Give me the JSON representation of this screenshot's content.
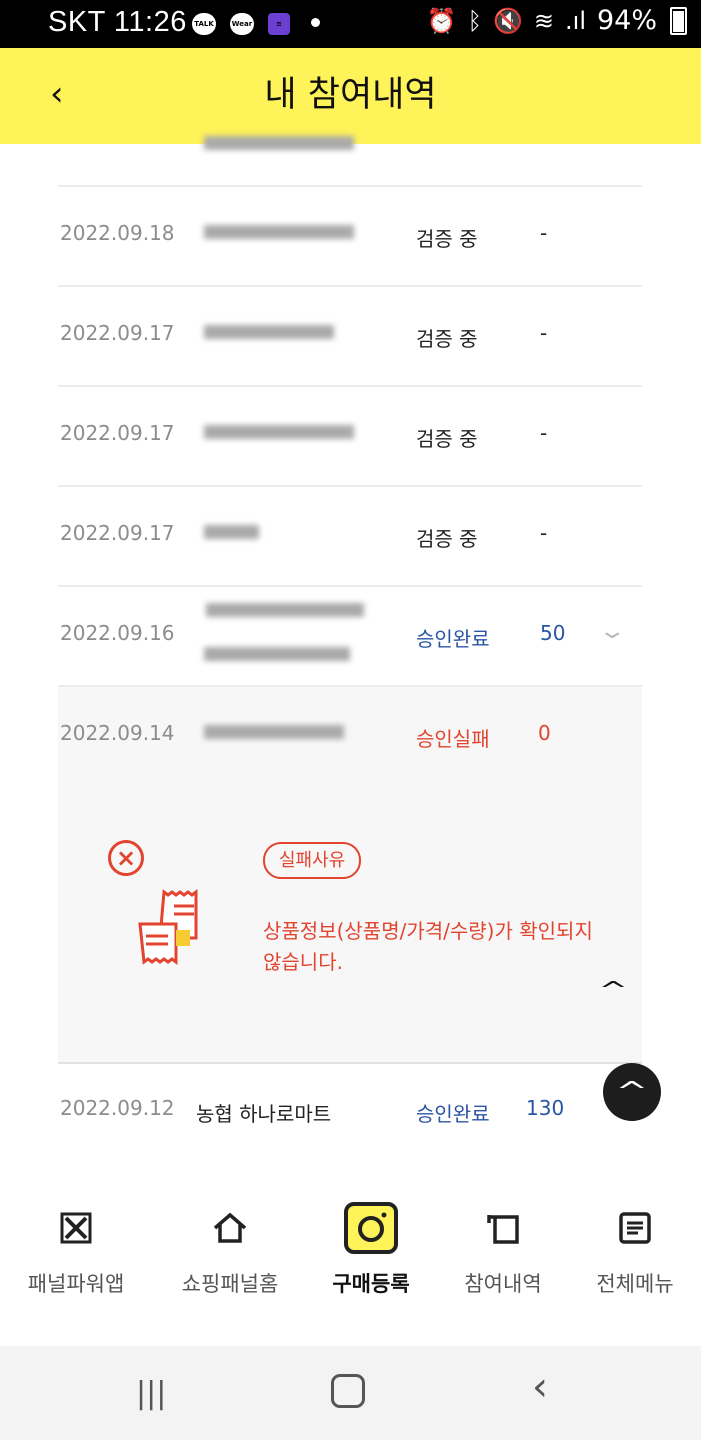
{
  "status_bar": {
    "carrier_time": "SKT 11:26",
    "talk_icon_text": "TALK",
    "wear_icon_text": "Wear",
    "battery": "94%"
  },
  "header": {
    "title": "내 참여내역",
    "back_icon": "back-chevron-icon"
  },
  "rows": [
    {
      "date": "2022.09.18",
      "status": "검증 중",
      "points": "-"
    },
    {
      "date": "2022.09.17",
      "status": "검증 중",
      "points": "-"
    },
    {
      "date": "2022.09.17",
      "status": "검증 중",
      "points": "-"
    },
    {
      "date": "2022.09.17",
      "status": "검증 중",
      "points": "-"
    },
    {
      "date": "2022.09.16",
      "status": "승인완료",
      "points": "50"
    },
    {
      "date": "2022.09.14",
      "status": "승인실패",
      "points": "0"
    }
  ],
  "failure_detail": {
    "badge": "실패사유",
    "reason": "상품정보(상품명/가격/수량)가 확인되지 않습니다."
  },
  "last_row": {
    "date": "2022.09.12",
    "store": "농협 하나로마트",
    "status": "승인완료",
    "points": "130"
  },
  "colors": {
    "header_bg": "#fff35a",
    "approved": "#2a55a4",
    "failed": "#e2442f"
  },
  "bottom_nav": [
    {
      "label": "패널파워앱",
      "icon": "panelpower-icon"
    },
    {
      "label": "쇼핑패널홈",
      "icon": "home-icon"
    },
    {
      "label": "구매등록",
      "icon": "camera-icon",
      "active": true
    },
    {
      "label": "참여내역",
      "icon": "history-icon"
    },
    {
      "label": "전체메뉴",
      "icon": "menu-list-icon"
    }
  ]
}
